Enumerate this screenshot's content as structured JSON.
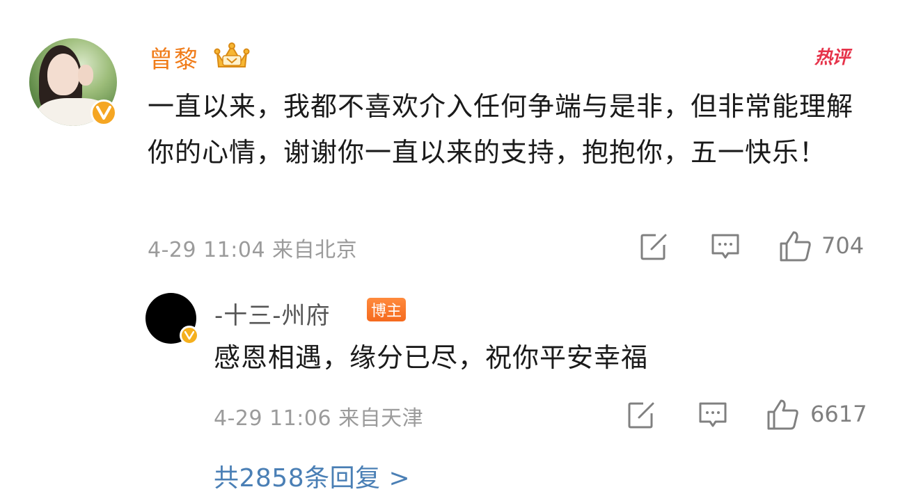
{
  "main_comment": {
    "author": "曾黎",
    "avatar_icon": "user-avatar-photo",
    "verified_icon": "verified-v-badge",
    "crown_icon": "crown-vip-badge",
    "hot_tag": "热评",
    "text": "一直以来，我都不喜欢介入任何争端与是非，但非常能理解你的心情，谢谢你一直以来的支持，抱抱你，五一快乐！",
    "meta": "4-29 11:04 来自北京",
    "likes": "704"
  },
  "reply": {
    "author": "-十三-州府",
    "badge": "博主",
    "avatar_icon": "user-avatar-black",
    "verified_icon": "verified-v-badge",
    "text": "感恩相遇，缘分已尽，祝你平安幸福",
    "meta": "4-29 11:06 来自天津",
    "likes": "6617"
  },
  "more_replies": "共2858条回复 >",
  "colors": {
    "author_orange": "#f07c1a",
    "hot_red": "#e6334a",
    "meta_gray": "#9b9b9b",
    "link_blue": "#4a7fb5",
    "badge_orange": "#f56a1e"
  }
}
